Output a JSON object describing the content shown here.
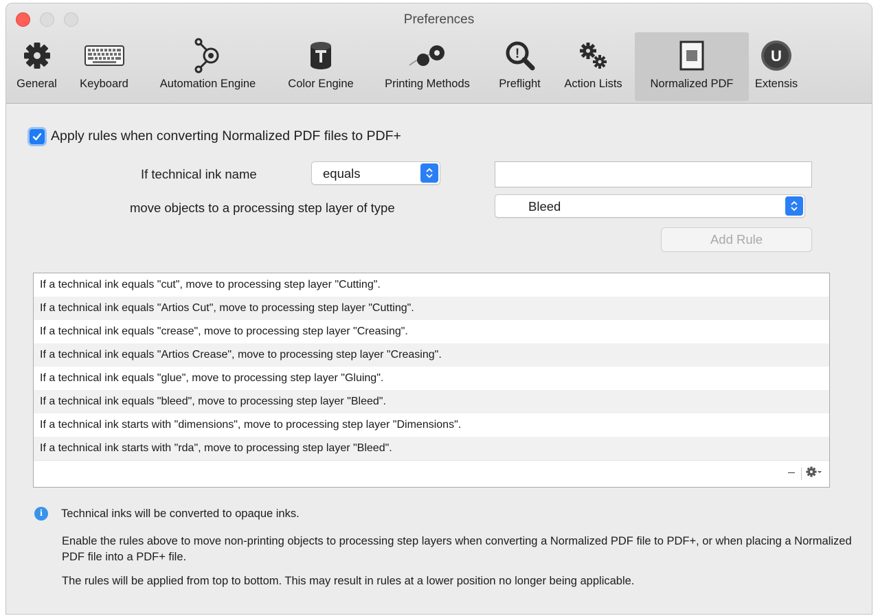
{
  "window": {
    "title": "Preferences"
  },
  "toolbar": {
    "tabs": [
      {
        "label": "General",
        "icon": "gear-icon"
      },
      {
        "label": "Keyboard",
        "icon": "keyboard-icon"
      },
      {
        "label": "Automation Engine",
        "icon": "automation-engine-icon"
      },
      {
        "label": "Color Engine",
        "icon": "color-engine-icon"
      },
      {
        "label": "Printing Methods",
        "icon": "printing-methods-icon"
      },
      {
        "label": "Preflight",
        "icon": "preflight-icon"
      },
      {
        "label": "Action Lists",
        "icon": "action-lists-icon"
      },
      {
        "label": "Normalized PDF",
        "icon": "normalized-pdf-icon"
      },
      {
        "label": "Extensis",
        "icon": "extensis-icon"
      }
    ],
    "selected": "Normalized PDF"
  },
  "form": {
    "apply_rules_label": "Apply rules when converting Normalized PDF files to PDF+",
    "apply_rules_checked": true,
    "ink_name_label": "If technical ink name",
    "ink_operator_value": "equals",
    "ink_name_value": "",
    "move_objects_label": "move objects to a processing step layer of type",
    "layer_type_value": "Bleed",
    "add_rule_label": "Add Rule"
  },
  "rules": [
    "If a technical ink equals \"cut\", move to processing step layer \"Cutting\".",
    "If a technical ink equals \"Artios Cut\", move to processing step layer \"Cutting\".",
    "If a technical ink equals \"crease\", move to processing step layer \"Creasing\".",
    "If a technical ink equals \"Artios Crease\", move to processing step layer \"Creasing\".",
    "If a technical ink equals \"glue\", move to processing step layer \"Gluing\".",
    "If a technical ink equals \"bleed\", move to processing step layer \"Bleed\".",
    "If a technical ink starts with \"dimensions\", move to processing step layer \"Dimensions\".",
    "If a technical ink starts with \"rda\", move to processing step layer \"Bleed\"."
  ],
  "list_footer": {
    "remove_label": "–",
    "actions_icon": "gear-icon"
  },
  "info": {
    "icon": "info-icon",
    "line1": "Technical inks will be converted to opaque inks.",
    "line2": "Enable the rules above to move non-printing objects to processing step layers when converting a Normalized PDF file to PDF+, or when placing a Normalized PDF file into a PDF+ file.",
    "line3": "The rules will be applied from top to bottom. This may result in rules at a lower position no longer being applicable."
  },
  "colors": {
    "accent": "#1e7cf4",
    "close": "#fe5f57",
    "info": "#3a93ea"
  }
}
